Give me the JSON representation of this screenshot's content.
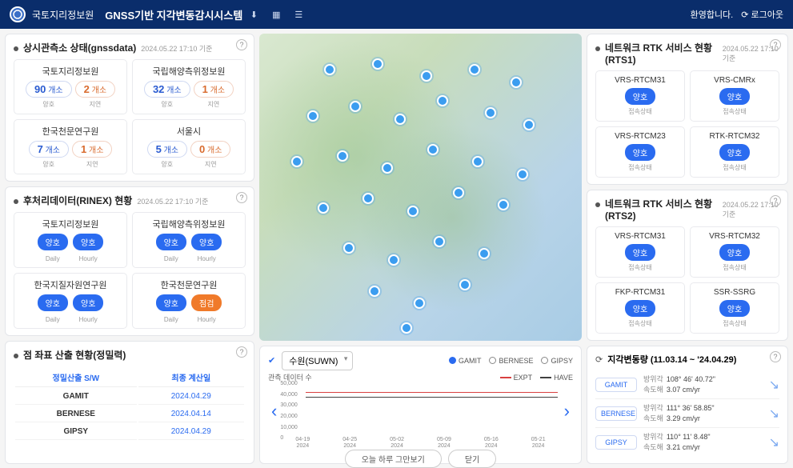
{
  "header": {
    "org": "국토지리정보원",
    "title": "GNSS기반 지각변동감시시스템",
    "greet": "환영합니다.",
    "logout": "로그아웃"
  },
  "panel_gnss": {
    "title": "상시관측소 상태(gnssdata)",
    "ts": "2024.05.22 17:10 기준",
    "unit_good": "개소",
    "unit_bad": "개소",
    "lbl_good": "양호",
    "lbl_bad": "지연",
    "items": [
      {
        "name": "국토지리정보원",
        "good": "90",
        "bad": "2"
      },
      {
        "name": "국립해양측위정보원",
        "good": "32",
        "bad": "1"
      },
      {
        "name": "한국천문연구원",
        "good": "7",
        "bad": "1"
      },
      {
        "name": "서울시",
        "good": "5",
        "bad": "0"
      }
    ]
  },
  "panel_rinex": {
    "title": "후처리데이터(RINEX) 현황",
    "ts": "2024.05.22 17:10 기준",
    "pill_ok": "양호",
    "pill_warn": "점검",
    "daily": "Daily",
    "hourly": "Hourly",
    "items": [
      {
        "name": "국토지리정보원",
        "d": "ok",
        "h": "ok"
      },
      {
        "name": "국립해양측위정보원",
        "d": "ok",
        "h": "ok"
      },
      {
        "name": "한국지질자원연구원",
        "d": "ok",
        "h": "ok"
      },
      {
        "name": "한국천문연구원",
        "d": "ok",
        "h": "warn"
      }
    ]
  },
  "panel_coord": {
    "title": "점 좌표 산출 현황(정밀력)",
    "col1": "정밀산출 S/W",
    "col2": "최종 계산일",
    "rows": [
      {
        "sw": "GAMIT",
        "date": "2024.04.29"
      },
      {
        "sw": "BERNESE",
        "date": "2024.04.14"
      },
      {
        "sw": "GIPSY",
        "date": "2024.04.29"
      }
    ]
  },
  "chart": {
    "station": "수원(SUWN)",
    "leg_gamit": "GAMIT",
    "leg_bernese": "BERNESE",
    "leg_gipsy": "GIPSY",
    "leg_expt": "EXPT",
    "leg_have": "HAVE",
    "sub": "관측 데이터 수",
    "btn_hide": "오늘 하루 그만보기",
    "btn_close": "닫기"
  },
  "chart_data": {
    "type": "line",
    "ylim": [
      0,
      50000
    ],
    "y_ticks": [
      0,
      10000,
      20000,
      30000,
      40000,
      50000
    ],
    "x_labels": [
      "04-19 2024",
      "04-25 2024",
      "05-02 2024",
      "05-09 2024",
      "05-16 2024",
      "05-21 2024"
    ],
    "series": [
      {
        "name": "EXPT",
        "color": "#d94040",
        "value_approx": 42000
      },
      {
        "name": "HAVE",
        "color": "#404040",
        "value_approx": 38000
      }
    ]
  },
  "rtk1": {
    "title": "네트워크 RTK 서비스 현황 (RTS1)",
    "ts": "2024.05.22 17:10 기준",
    "status_ok": "양호",
    "status_lbl": "접속상태",
    "items": [
      "VRS-RTCM31",
      "VRS-CMRx",
      "VRS-RTCM23",
      "RTK-RTCM32"
    ]
  },
  "rtk2": {
    "title": "네트워크 RTK 서비스 현황 (RTS2)",
    "ts": "2024.05.22 17:10 기준",
    "status_ok": "양호",
    "status_lbl": "접속상태",
    "items": [
      "VRS-RTCM31",
      "VRS-RTCM32",
      "FKP-RTCM31",
      "SSR-SSRG"
    ]
  },
  "disp": {
    "title": "지각변동량 (11.03.14 ~ '24.04.29)",
    "k_az": "방위각",
    "k_sp": "속도해",
    "rows": [
      {
        "tag": "GAMIT",
        "az": "108° 46' 40.72\"",
        "sp": "3.07 cm/yr"
      },
      {
        "tag": "BERNESE",
        "az": "111° 36' 58.85\"",
        "sp": "3.29 cm/yr"
      },
      {
        "tag": "GIPSY",
        "az": "110° 11' 8.48\"",
        "sp": "3.21 cm/yr"
      }
    ]
  }
}
